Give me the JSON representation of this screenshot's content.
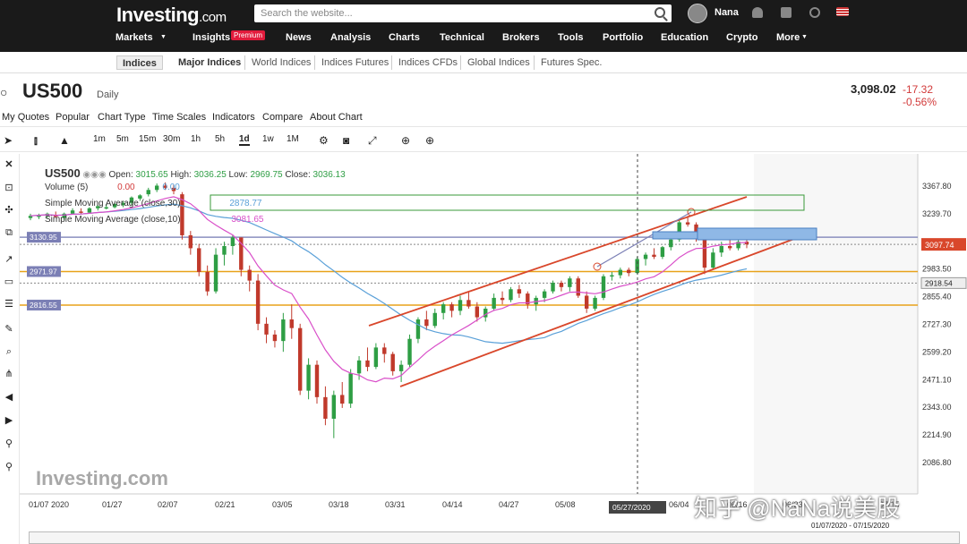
{
  "header": {
    "logo": "Investing",
    "logo_suffix": ".com",
    "search_placeholder": "Search the website...",
    "username": "Nana"
  },
  "nav": {
    "items": [
      "Markets",
      "Insights",
      "News",
      "Analysis",
      "Charts",
      "Technical",
      "Brokers",
      "Tools",
      "Portfolio",
      "Education",
      "Crypto",
      "More"
    ],
    "premium_badge": "Premium"
  },
  "subnav": {
    "items": [
      "Indices",
      "Major Indices",
      "World Indices",
      "Indices Futures",
      "Indices CFDs",
      "Global Indices",
      "Futures Spec."
    ]
  },
  "instrument": {
    "symbol": "US500",
    "period": "Daily",
    "last": "3,098.02",
    "change": "-17.32",
    "change_pct": "-0.56%"
  },
  "chart_menu": [
    "My Quotes",
    "Popular",
    "Chart Type",
    "Time Scales",
    "Indicators",
    "Compare",
    "About Chart"
  ],
  "timeframes": [
    "1m",
    "5m",
    "15m",
    "30m",
    "1h",
    "5h",
    "1d",
    "1w",
    "1M"
  ],
  "legend": {
    "symbol": "US500",
    "open_label": "Open:",
    "open": "3015.65",
    "high_label": "High:",
    "high": "3036.25",
    "low_label": "Low:",
    "low": "2969.75",
    "close_label": "Close:",
    "close": "3036.13",
    "volume_label": "Volume (5)",
    "volume_vals": "0.00",
    "volume_vals2": "0.00",
    "sma30_label": "Simple Moving Average (close,30)",
    "sma30_val": "2878.77",
    "sma10_label": "Simple Moving Average (close,10)",
    "sma10_val": "3081.65"
  },
  "watermark": "Investing.com",
  "watermark_cn": "知乎 @NaNa说美股",
  "colors": {
    "up": "#2e9e44",
    "down": "#c0392b",
    "sma10": "#d94fc9",
    "sma30": "#5aa0d8",
    "channel": "#d9472b",
    "level": "#e8a21a"
  },
  "chart_data": {
    "type": "candlestick",
    "y_ticks": [
      "3367.80",
      "3239.70",
      "3111.60",
      "2983.50",
      "2855.40",
      "2727.30",
      "2599.20",
      "2471.10",
      "2343.00",
      "2214.90",
      "2086.80"
    ],
    "x_ticks": [
      "01/07 2020",
      "01/27",
      "02/07",
      "02/21",
      "03/05",
      "03/18",
      "03/31",
      "04/14",
      "04/27",
      "05/08",
      "05/27/2020",
      "06/04",
      "06/16",
      "06/23",
      "07/15"
    ],
    "level_labels": [
      "3130.95",
      "2971.97",
      "2816.55"
    ],
    "right_labels": [
      "3097.74",
      "2918.54"
    ],
    "cursor_date": "05/27/2020",
    "range_label": "01/07/2020 - 07/15/2020",
    "ohlc": [
      [
        3220,
        3240,
        3210,
        3230
      ],
      [
        3225,
        3240,
        3215,
        3235
      ],
      [
        3230,
        3245,
        3220,
        3240
      ],
      [
        3235,
        3250,
        3225,
        3225
      ],
      [
        3220,
        3245,
        3210,
        3240
      ],
      [
        3240,
        3265,
        3235,
        3255
      ],
      [
        3250,
        3265,
        3240,
        3245
      ],
      [
        3245,
        3270,
        3240,
        3265
      ],
      [
        3265,
        3280,
        3255,
        3275
      ],
      [
        3270,
        3285,
        3260,
        3270
      ],
      [
        3270,
        3290,
        3265,
        3285
      ],
      [
        3280,
        3300,
        3270,
        3290
      ],
      [
        3290,
        3320,
        3280,
        3315
      ],
      [
        3310,
        3330,
        3300,
        3325
      ],
      [
        3330,
        3360,
        3320,
        3350
      ],
      [
        3350,
        3380,
        3340,
        3370
      ],
      [
        3370,
        3385,
        3350,
        3360
      ],
      [
        3360,
        3375,
        3330,
        3345
      ],
      [
        3330,
        3340,
        3120,
        3140
      ],
      [
        3140,
        3160,
        3050,
        3080
      ],
      [
        3080,
        3100,
        2950,
        2970
      ],
      [
        2970,
        3000,
        2860,
        2880
      ],
      [
        2880,
        3080,
        2870,
        3050
      ],
      [
        3050,
        3110,
        3000,
        3090
      ],
      [
        3090,
        3140,
        3050,
        3130
      ],
      [
        3130,
        3130,
        2950,
        2980
      ],
      [
        2980,
        3000,
        2880,
        2930
      ],
      [
        2930,
        2960,
        2700,
        2730
      ],
      [
        2730,
        2760,
        2640,
        2680
      ],
      [
        2680,
        2700,
        2620,
        2650
      ],
      [
        2650,
        2780,
        2600,
        2750
      ],
      [
        2750,
        2820,
        2660,
        2710
      ],
      [
        2710,
        2730,
        2400,
        2420
      ],
      [
        2420,
        2570,
        2380,
        2540
      ],
      [
        2540,
        2560,
        2360,
        2390
      ],
      [
        2390,
        2440,
        2260,
        2290
      ],
      [
        2290,
        2420,
        2200,
        2400
      ],
      [
        2400,
        2460,
        2340,
        2360
      ],
      [
        2360,
        2520,
        2340,
        2500
      ],
      [
        2500,
        2580,
        2470,
        2560
      ],
      [
        2560,
        2620,
        2510,
        2530
      ],
      [
        2530,
        2640,
        2520,
        2620
      ],
      [
        2620,
        2640,
        2550,
        2590
      ],
      [
        2590,
        2600,
        2490,
        2510
      ],
      [
        2510,
        2560,
        2460,
        2540
      ],
      [
        2540,
        2680,
        2530,
        2660
      ],
      [
        2660,
        2760,
        2640,
        2750
      ],
      [
        2750,
        2790,
        2700,
        2720
      ],
      [
        2720,
        2800,
        2710,
        2780
      ],
      [
        2780,
        2830,
        2750,
        2820
      ],
      [
        2820,
        2830,
        2760,
        2790
      ],
      [
        2790,
        2860,
        2770,
        2840
      ],
      [
        2840,
        2880,
        2800,
        2810
      ],
      [
        2810,
        2830,
        2740,
        2760
      ],
      [
        2760,
        2810,
        2740,
        2800
      ],
      [
        2800,
        2870,
        2790,
        2850
      ],
      [
        2850,
        2880,
        2820,
        2840
      ],
      [
        2840,
        2900,
        2830,
        2890
      ],
      [
        2890,
        2910,
        2850,
        2870
      ],
      [
        2870,
        2880,
        2800,
        2820
      ],
      [
        2820,
        2860,
        2790,
        2850
      ],
      [
        2850,
        2890,
        2830,
        2880
      ],
      [
        2880,
        2930,
        2870,
        2920
      ],
      [
        2920,
        2930,
        2880,
        2900
      ],
      [
        2900,
        2950,
        2880,
        2940
      ],
      [
        2940,
        2950,
        2850,
        2860
      ],
      [
        2860,
        2880,
        2780,
        2800
      ],
      [
        2800,
        2860,
        2790,
        2850
      ],
      [
        2850,
        2960,
        2840,
        2950
      ],
      [
        2950,
        2970,
        2930,
        2955
      ],
      [
        2955,
        2990,
        2940,
        2980
      ],
      [
        2980,
        2990,
        2950,
        2965
      ],
      [
        2965,
        3040,
        2960,
        3030
      ],
      [
        3030,
        3060,
        3000,
        3050
      ],
      [
        3050,
        3080,
        3030,
        3040
      ],
      [
        3040,
        3090,
        3030,
        3085
      ],
      [
        3085,
        3130,
        3070,
        3120
      ],
      [
        3120,
        3210,
        3110,
        3200
      ],
      [
        3200,
        3230,
        3180,
        3190
      ],
      [
        3190,
        3200,
        3110,
        3130
      ],
      [
        3130,
        3130,
        2960,
        2990
      ],
      [
        2990,
        3080,
        2980,
        3060
      ],
      [
        3060,
        3110,
        3040,
        3090
      ],
      [
        3090,
        3120,
        3070,
        3080
      ],
      [
        3080,
        3130,
        3070,
        3110
      ],
      [
        3110,
        3130,
        3080,
        3098
      ]
    ]
  }
}
